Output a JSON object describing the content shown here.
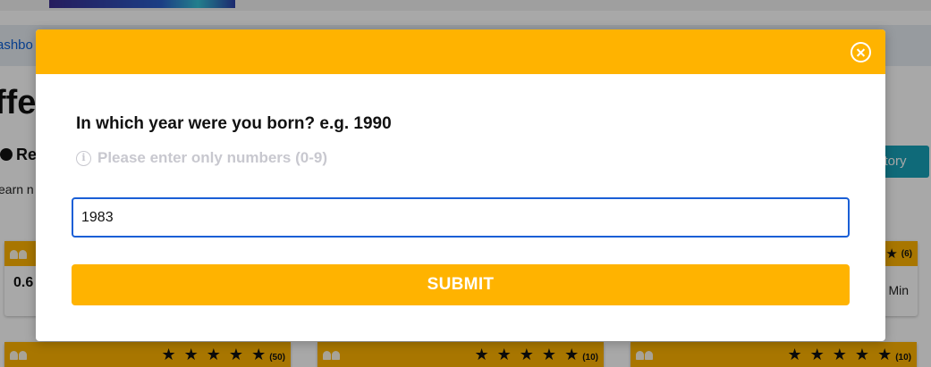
{
  "background": {
    "breadcrumb": "ashbo",
    "page_title": "ffe",
    "section_label": "Re",
    "sub_text": "earn n",
    "history_button": "story",
    "cards_row1": [
      {
        "value": "0.6"
      },
      {
        "count": "(6)",
        "unit": "Min"
      }
    ],
    "cards_row2": [
      {
        "stars": "★ ★ ★ ★ ★",
        "count": "(50)"
      },
      {
        "stars": "★ ★ ★ ★ ★",
        "count": "(10)"
      },
      {
        "stars": "★ ★ ★ ★ ★",
        "count": "(10)"
      }
    ]
  },
  "modal": {
    "question": "In which year were you born? e.g. 1990",
    "hint_icon": "i",
    "hint": "Please enter only numbers (0-9)",
    "input_value": "1983",
    "submit_label": "SUBMIT"
  },
  "colors": {
    "accent": "#ffb300",
    "input_border": "#1a5fd6",
    "hint": "#c8c8cf"
  },
  "icons": {
    "close": "close-icon",
    "info": "info-icon",
    "users": "users-icon"
  }
}
